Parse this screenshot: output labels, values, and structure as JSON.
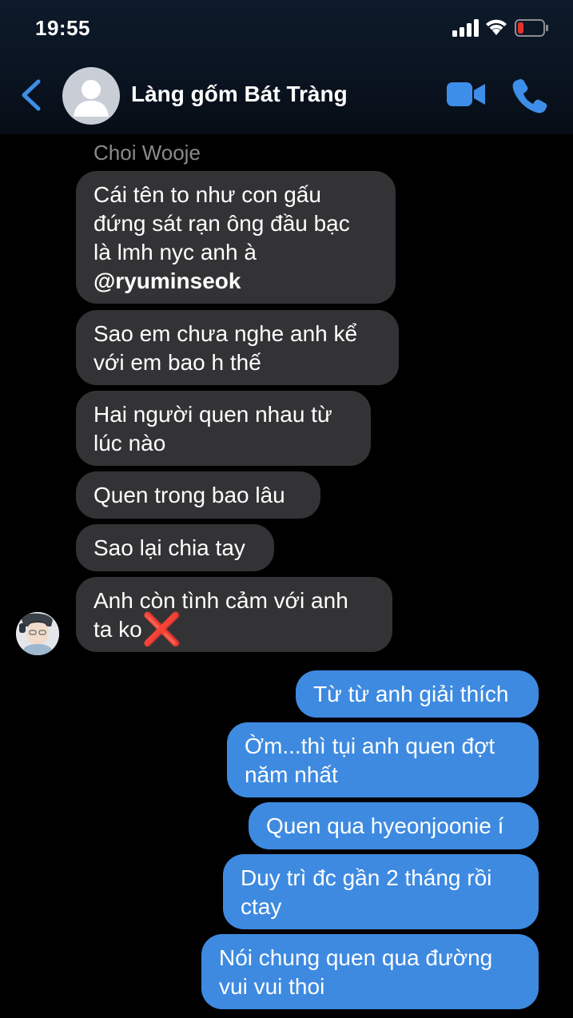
{
  "status_bar": {
    "time": "19:55"
  },
  "header": {
    "contact_name": "Làng gốm Bát Tràng"
  },
  "conversation": {
    "sender_name": "Choi Wooje",
    "incoming": [
      {
        "lines": [
          "Cái tên to như con gấu",
          "đứng sát rạn ông đầu bạc",
          "là lmh nyc anh à"
        ],
        "mention": "@ryuminseok"
      },
      {
        "lines": [
          "Sao em chưa nghe anh kể",
          "với em bao h thế"
        ]
      },
      {
        "lines": [
          "Hai người quen nhau từ",
          "lúc nào"
        ]
      },
      {
        "lines": [
          "Quen trong bao lâu"
        ]
      },
      {
        "lines": [
          "Sao lại chia tay"
        ]
      },
      {
        "lines": [
          "Anh còn tình cảm với anh",
          "ta ko"
        ],
        "emoji": "❌"
      }
    ],
    "outgoing": [
      {
        "lines": [
          "Từ từ anh giải thích"
        ]
      },
      {
        "lines": [
          "Ờm...thì tụi anh quen đợt",
          "năm nhất"
        ]
      },
      {
        "lines": [
          "Quen qua hyeonjoonie í"
        ]
      },
      {
        "lines": [
          "Duy trì đc gần 2 tháng rồi",
          "ctay"
        ]
      },
      {
        "lines": [
          "Nói chung quen qua đường",
          "vui vui thoi"
        ]
      }
    ]
  },
  "colors": {
    "incoming_bubble": "#333335",
    "outgoing_bubble": "#3e8ae0",
    "accent": "#3d8ee8",
    "battery_low": "#e5322d"
  }
}
